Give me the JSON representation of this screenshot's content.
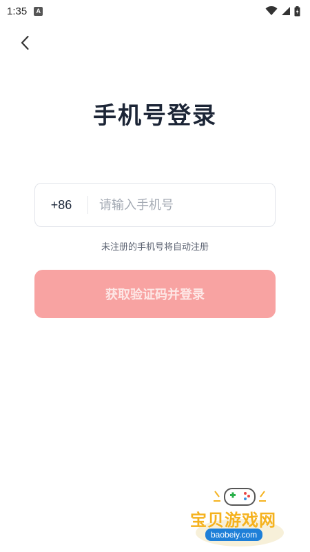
{
  "status_bar": {
    "time": "1:35",
    "notification_icon": "A"
  },
  "header": {
    "back_icon": "chevron-left-icon",
    "title": "手机号登录"
  },
  "form": {
    "country_code": "+86",
    "phone_value": "",
    "phone_placeholder": "请输入手机号",
    "hint": "未注册的手机号将自动注册",
    "submit_label": "获取验证码并登录"
  },
  "watermark": {
    "site_name": "宝贝游戏网",
    "url": "baobeiy.com"
  },
  "colors": {
    "title": "#1c2536",
    "button_bg": "#f8a3a2",
    "button_text": "#fde7e6",
    "watermark_text": "#f5b21e",
    "watermark_url_bg": "#1e7fd8"
  }
}
